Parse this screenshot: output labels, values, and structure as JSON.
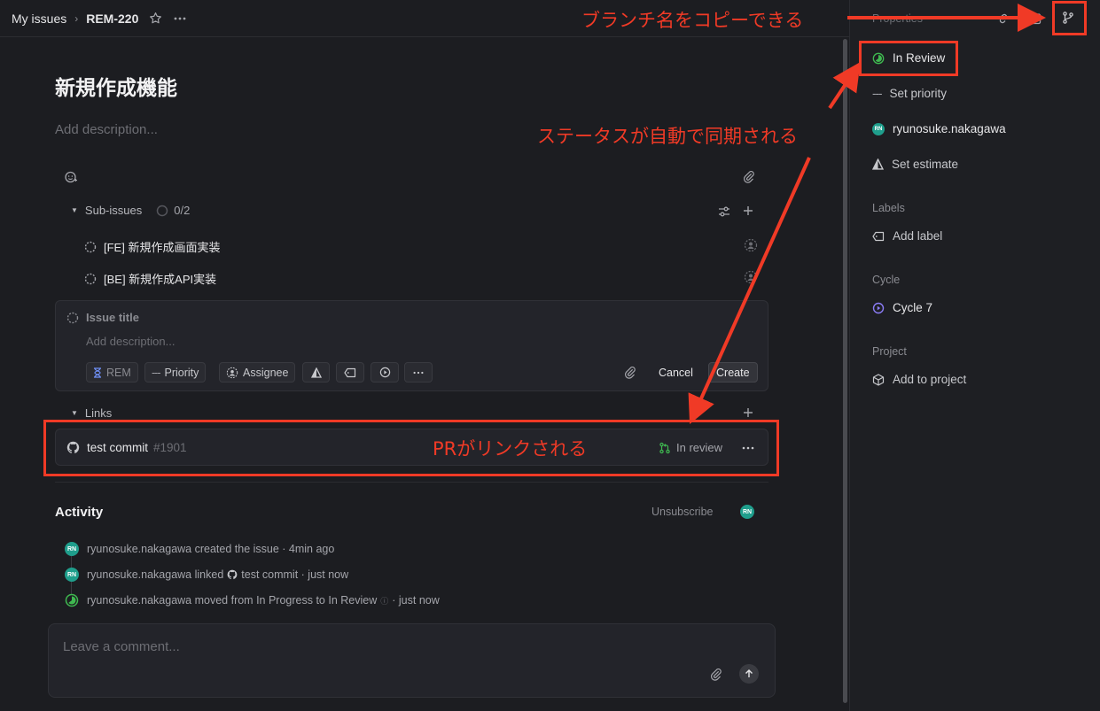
{
  "breadcrumb": {
    "parent": "My issues",
    "current": "REM-220"
  },
  "issue": {
    "title": "新規作成機能",
    "description_placeholder": "Add description..."
  },
  "subissues": {
    "label": "Sub-issues",
    "progress": "0/2",
    "progress_fraction": 0,
    "items": [
      {
        "title": "[FE] 新規作成画面実装"
      },
      {
        "title": "[BE] 新規作成API実装"
      }
    ]
  },
  "new_issue": {
    "title_placeholder": "Issue title",
    "description_placeholder": "Add description...",
    "chips": {
      "team": "REM",
      "priority": "Priority",
      "assignee": "Assignee"
    },
    "cancel_label": "Cancel",
    "create_label": "Create"
  },
  "links": {
    "label": "Links",
    "items": [
      {
        "title": "test commit",
        "number": "#1901",
        "status": "In review"
      }
    ]
  },
  "activity": {
    "title": "Activity",
    "unsubscribe_label": "Unsubscribe",
    "avatar_initials": "RN",
    "events": [
      {
        "text": "ryunosuke.nakagawa created the issue · 4min ago"
      },
      {
        "pre": "ryunosuke.nakagawa linked",
        "post": "test commit · just now"
      },
      {
        "pre": "ryunosuke.nakagawa moved from In Progress to In Review",
        "post": "· just now"
      }
    ]
  },
  "comment": {
    "placeholder": "Leave a comment..."
  },
  "sidebar": {
    "header": "Properties",
    "status": "In Review",
    "priority": "Set priority",
    "assignee": "ryunosuke.nakagawa",
    "estimate": "Set estimate",
    "labels_header": "Labels",
    "add_label": "Add label",
    "cycle_header": "Cycle",
    "cycle": "Cycle 7",
    "project_header": "Project",
    "add_project": "Add to project"
  },
  "annotations": {
    "branch": "ブランチ名をコピーできる",
    "status_sync": "ステータスが自動で同期される",
    "pr_link": "PRがリンクされる"
  },
  "colors": {
    "annotation": "#f03a26",
    "status_green": "#3fb950",
    "avatar_teal": "#1f9e8c",
    "cycle_purple": "#8b7cf6"
  }
}
